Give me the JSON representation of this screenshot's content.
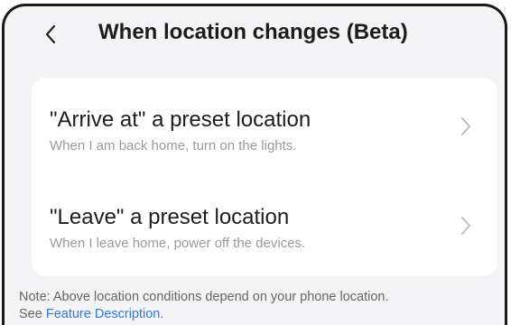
{
  "header": {
    "back_icon": "chevron-left-icon",
    "title": "When location changes (Beta)"
  },
  "options": [
    {
      "title": "\"Arrive at\" a preset location",
      "subtitle": "When I am back home, turn on the lights.",
      "icon": "chevron-right-icon"
    },
    {
      "title": "\"Leave\" a preset location",
      "subtitle": "When I leave home, power off the devices.",
      "icon": "chevron-right-icon"
    }
  ],
  "note": {
    "line1": "Note: Above location conditions depend on your phone location.",
    "line2_prefix": "See ",
    "link_text": "Feature Description",
    "line2_suffix": "."
  },
  "colors": {
    "background": "#f4f4f6",
    "card": "#ffffff",
    "link": "#2d7be0",
    "frame": "#1a1a1a"
  }
}
